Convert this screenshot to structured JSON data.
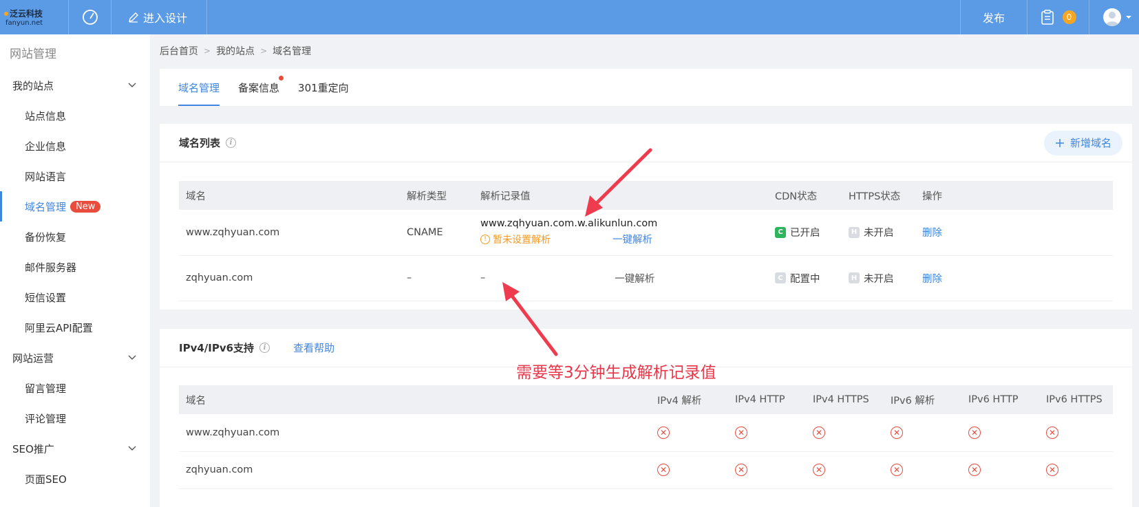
{
  "topbar": {
    "logo_main": "泛云科技",
    "logo_sub": "fanyun.net",
    "design_label": "进入设计",
    "publish_label": "发布",
    "task_count": "0",
    "accent": "#5b9be6"
  },
  "sidebar": {
    "title": "网站管理",
    "groups": [
      {
        "label": "我的站点",
        "items": [
          "站点信息",
          "企业信息",
          "网站语言",
          "域名管理",
          "备份恢复",
          "邮件服务器",
          "短信设置",
          "阿里云API配置"
        ]
      },
      {
        "label": "网站运营",
        "items": [
          "留言管理",
          "评论管理"
        ]
      },
      {
        "label": "SEO推广",
        "items": [
          "页面SEO"
        ]
      }
    ],
    "active_item": "域名管理",
    "new_badge": "New"
  },
  "breadcrumb": [
    "后台首页",
    "我的站点",
    "域名管理"
  ],
  "tabs": [
    {
      "label": "域名管理",
      "active": true
    },
    {
      "label": "备案信息",
      "dot": true
    },
    {
      "label": "301重定向"
    }
  ],
  "domain_list": {
    "title": "域名列表",
    "add_label": "新增域名",
    "columns": [
      "域名",
      "解析类型",
      "解析记录值",
      "CDN状态",
      "HTTPS状态",
      "操作"
    ],
    "rows": [
      {
        "domain": "www.zqhyuan.com",
        "type": "CNAME",
        "record": "www.zqhyuan.com.w.alikunlun.com",
        "warning": "暂未设置解析",
        "quick": "一键解析",
        "cdn": "已开启",
        "cdn_icon": "C",
        "https": "未开启",
        "https_icon": "H",
        "action": "删除"
      },
      {
        "domain": "zqhyuan.com",
        "type": "–",
        "record": "–",
        "warning": "",
        "quick": "一键解析",
        "cdn": "配置中",
        "cdn_icon": "C",
        "https": "未开启",
        "https_icon": "H",
        "action": "删除"
      }
    ]
  },
  "ipv": {
    "title": "IPv4/IPv6支持",
    "help_label": "查看帮助",
    "columns": [
      "域名",
      "IPv4 解析",
      "IPv4 HTTP",
      "IPv4 HTTPS",
      "IPv6 解析",
      "IPv6 HTTP",
      "IPv6 HTTPS"
    ],
    "rows": [
      {
        "domain": "www.zqhyuan.com"
      },
      {
        "domain": "zqhyuan.com"
      }
    ]
  },
  "annotation": "需要等3分钟生成解析记录值"
}
